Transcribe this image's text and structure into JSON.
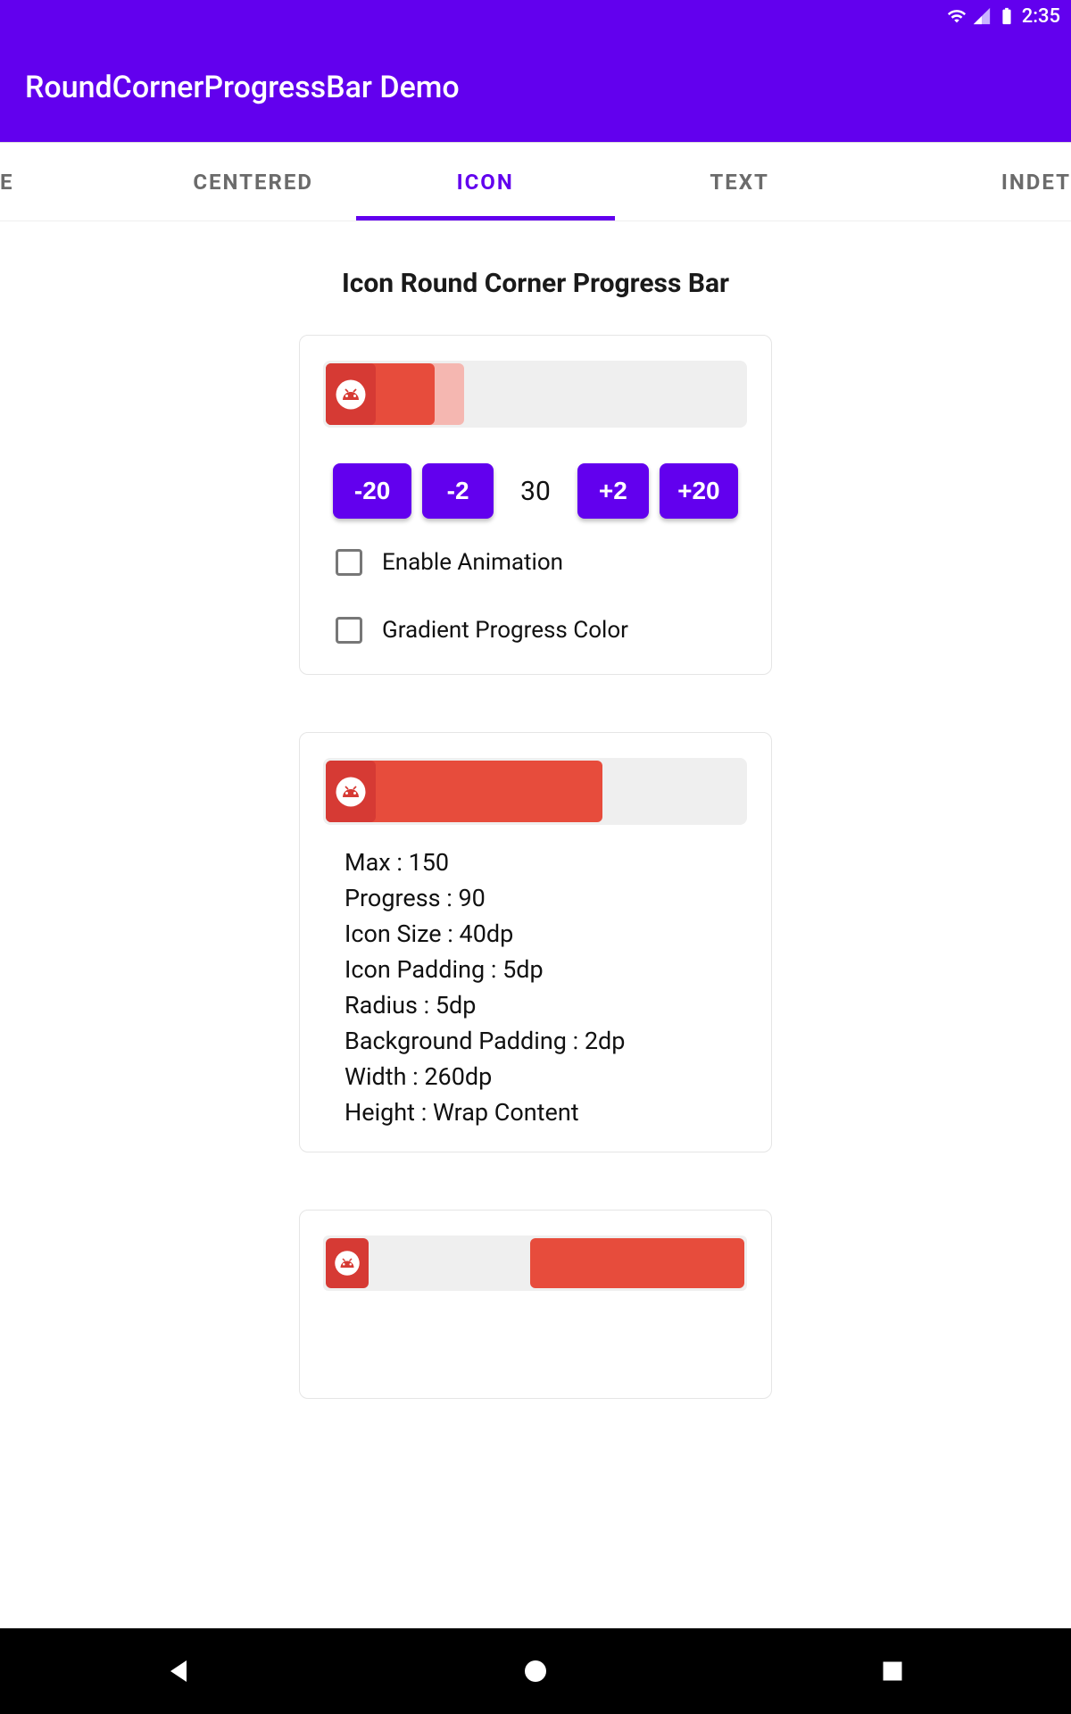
{
  "status": {
    "time": "2:35"
  },
  "appbar": {
    "title": "RoundCornerProgressBar Demo"
  },
  "tabs": {
    "left_edge": "E",
    "centered": "CENTERED",
    "icon": "ICON",
    "text": "TEXT",
    "right_edge": "INDET"
  },
  "page": {
    "title": "Icon Round Corner Progress Bar"
  },
  "card1": {
    "value": "30",
    "buttons": {
      "m20": "-20",
      "m2": "-2",
      "p2": "+2",
      "p20": "+20"
    },
    "check_anim": "Enable Animation",
    "check_grad": "Gradient Progress Color"
  },
  "card2": {
    "specs": {
      "max": "Max : 150",
      "progress": "Progress : 90",
      "icon_size": "Icon Size : 40dp",
      "icon_padding": "Icon Padding : 5dp",
      "radius": "Radius : 5dp",
      "bg_padding": "Background Padding : 2dp",
      "width": "Width : 260dp",
      "height": "Height : Wrap Content"
    }
  }
}
